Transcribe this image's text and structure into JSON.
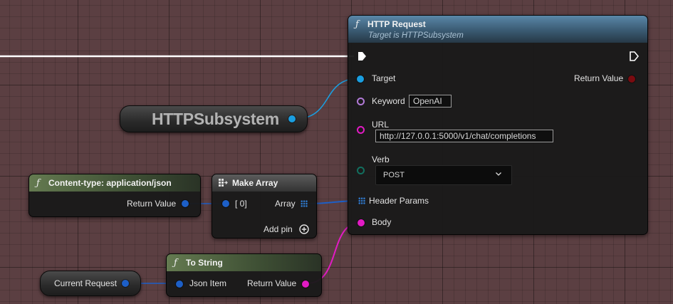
{
  "colors": {
    "object_pin": "#1a9ee0",
    "string_pin": "#e21bc4",
    "name_pin": "#b27ad8",
    "byte_pin": "#126f5f",
    "struct_pin": "#1d5fc7",
    "return_pin": "#7a0b10"
  },
  "http_request": {
    "icon": "function-icon",
    "title": "HTTP Request",
    "subtitle": "Target is HTTPSubsystem",
    "target_label": "Target",
    "return_label": "Return Value",
    "keyword_label": "Keyword",
    "keyword_value": "OpenAI",
    "url_label": "URL",
    "url_value": "http://127.0.0.1:5000/v1/chat/completions",
    "verb_label": "Verb",
    "verb_value": "POST",
    "header_params_label": "Header Params",
    "body_label": "Body"
  },
  "http_subsystem": {
    "label": "HTTPSubsystem"
  },
  "content_type": {
    "icon": "function-icon",
    "title": "Content-type: application/json",
    "return_label": "Return Value"
  },
  "make_array": {
    "icon": "make-array-icon",
    "title": "Make Array",
    "index_label": "[ 0]",
    "array_label": "Array",
    "add_pin_label": "Add pin"
  },
  "to_string": {
    "icon": "function-icon",
    "title": "To String",
    "input_label": "Json Item",
    "return_label": "Return Value"
  },
  "current_request": {
    "label": "Current Request"
  }
}
